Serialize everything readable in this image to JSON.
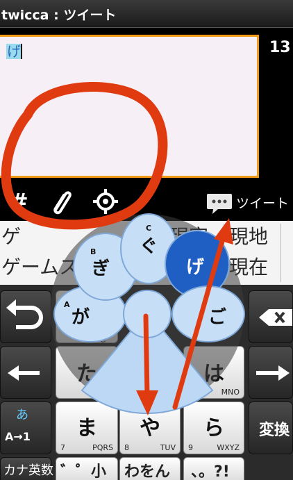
{
  "titlebar": {
    "title": "twicca : ツイート"
  },
  "editor": {
    "text": "げ",
    "counter": "13"
  },
  "toolbar": {
    "hashtag": "#",
    "attach_icon": "paperclip-icon",
    "location_icon": "crosshair-icon",
    "tweet_icon": "speech-bubble-icon",
    "tweet_label": "ツイート"
  },
  "candidates": {
    "row1": [
      "ゲ",
      "現実",
      "現地"
    ],
    "row2": [
      "ゲームス",
      "げ",
      "現在"
    ]
  },
  "keyboard": {
    "undo_icon": "undo-icon",
    "left_arrow_icon": "left-arrow-icon",
    "right_arrow_icon": "right-arrow-icon",
    "delete_icon": "backspace-icon",
    "keys": [
      {
        "kana": "ま",
        "num": "7",
        "letters": "PQRS"
      },
      {
        "kana": "や",
        "num": "8",
        "letters": "TUV"
      },
      {
        "kana": "ら",
        "num": "9",
        "letters": "WXYZ"
      },
      {
        "kana": "た",
        "num": "",
        "letters": ""
      },
      {
        "kana": "は",
        "num": "",
        "letters": "MNO"
      }
    ],
    "mode_top": "あ",
    "mode_bottom": "A→1",
    "convert": "変換",
    "bottom_row": [
      "カナ英数",
      "゛゜小",
      "わをん",
      "、。?!"
    ],
    "at_fragment": "@"
  },
  "flick": {
    "center": "",
    "left": {
      "kana": "が",
      "letter": "A"
    },
    "upper_left": {
      "kana": "ぎ",
      "letter": "B"
    },
    "top": {
      "kana": "ぐ",
      "letter": "C"
    },
    "upper_right": {
      "kana": "げ",
      "letter": ""
    },
    "right": {
      "kana": "ご",
      "letter": ""
    }
  },
  "annotation": {
    "color": "#e03a10",
    "arrow_color": "#e03a10"
  },
  "colors": {
    "accent": "#f29b18",
    "selection": "#9ad9ee",
    "flick_petal": "#bcd8f4",
    "flick_active": "#1f5fc4"
  }
}
